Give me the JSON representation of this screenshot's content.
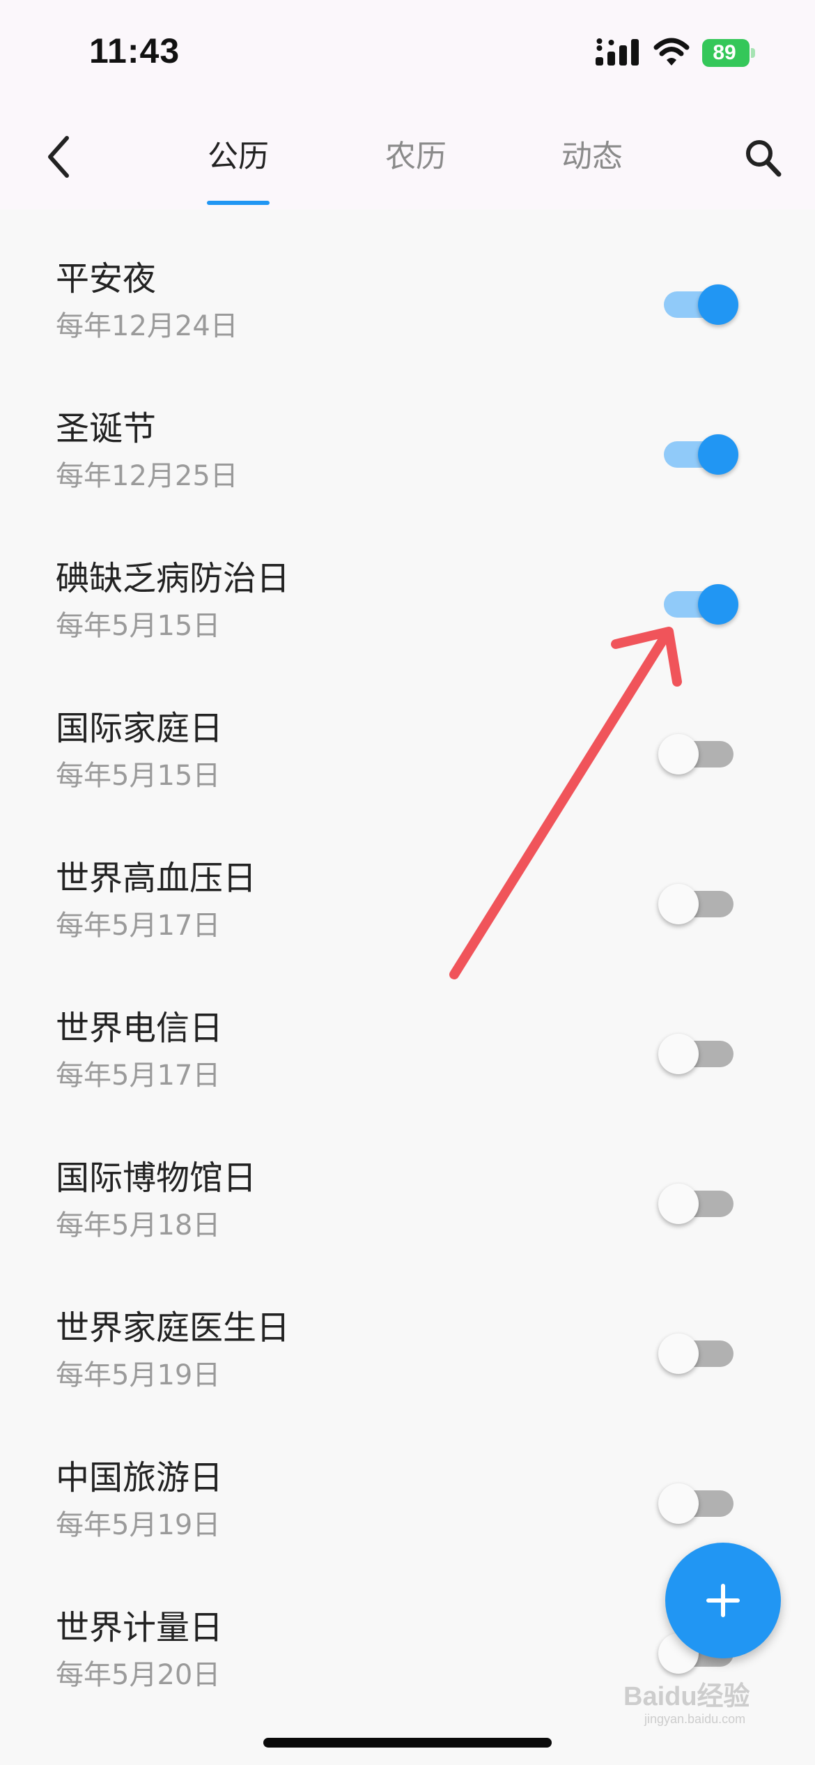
{
  "status_bar": {
    "time": "11:43",
    "battery": "89"
  },
  "header": {
    "tabs": [
      {
        "label": "公历",
        "active": true
      },
      {
        "label": "农历",
        "active": false
      },
      {
        "label": "动态",
        "active": false
      }
    ],
    "back_icon": "chevron-left-icon",
    "search_icon": "search-icon"
  },
  "holidays": [
    {
      "title": "平安夜",
      "date": "每年12月24日",
      "enabled": true
    },
    {
      "title": "圣诞节",
      "date": "每年12月25日",
      "enabled": true
    },
    {
      "title": "碘缺乏病防治日",
      "date": "每年5月15日",
      "enabled": true
    },
    {
      "title": "国际家庭日",
      "date": "每年5月15日",
      "enabled": false
    },
    {
      "title": "世界高血压日",
      "date": "每年5月17日",
      "enabled": false
    },
    {
      "title": "世界电信日",
      "date": "每年5月17日",
      "enabled": false
    },
    {
      "title": "国际博物馆日",
      "date": "每年5月18日",
      "enabled": false
    },
    {
      "title": "世界家庭医生日",
      "date": "每年5月19日",
      "enabled": false
    },
    {
      "title": "中国旅游日",
      "date": "每年5月19日",
      "enabled": false
    },
    {
      "title": "世界计量日",
      "date": "每年5月20日",
      "enabled": false
    }
  ],
  "fab_icon": "plus-icon",
  "watermark": {
    "text": "Baidu经验",
    "subtext": "jingyan.baidu.com"
  },
  "colors": {
    "accent": "#2196f3",
    "annotation_arrow": "#f0545a"
  }
}
